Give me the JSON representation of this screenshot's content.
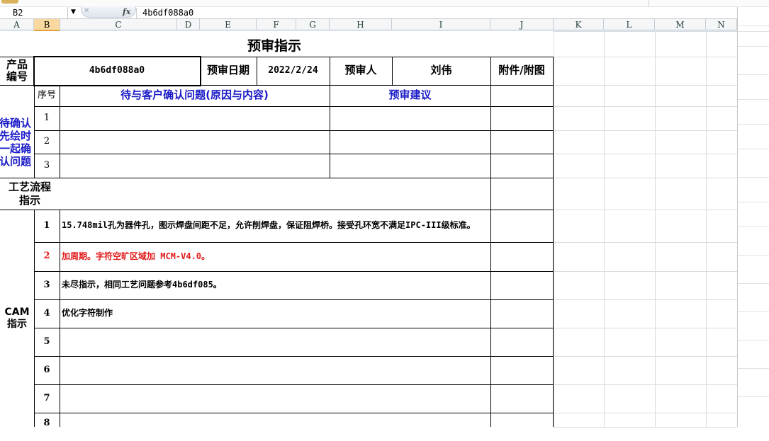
{
  "formula_bar": {
    "name_box": "B2",
    "function_icon": "fx",
    "formula": "4b6df088a0"
  },
  "columns": [
    "A",
    "B",
    "C",
    "D",
    "E",
    "F",
    "G",
    "H",
    "I",
    "J",
    "K",
    "L",
    "M",
    "N"
  ],
  "sheet": {
    "title": "预审指示",
    "product_label": "产品\n编号",
    "product_id": "4b6df088a0",
    "review_date_label": "预审日期",
    "review_date": "2022/2/24",
    "reviewer_label": "预审人",
    "reviewer": "刘伟",
    "attachment_label": "附件/附图",
    "seq_label": "序号",
    "customer_issue_header": "待与客户确认问题(原因与内容)",
    "suggestion_header": "预审建议",
    "confirm_section_label": "待确认\n先绘时\n一起确\n认问题",
    "confirm_rows": [
      "1",
      "2",
      "3"
    ],
    "process_label": "工艺流程\n指示",
    "cam_label": "CAM\n指示",
    "cam_rows": [
      {
        "num": "1",
        "text": "15.748mil孔为器件孔，图示焊盘间距不足，允许削焊盘，保证阻焊桥。接受孔环宽不满足IPC-III级标准。"
      },
      {
        "num": "2",
        "text": "加周期。字符空旷区域加 MCM-V4.0。"
      },
      {
        "num": "3",
        "text": "未尽指示，相同工艺问题参考4b6df085。"
      },
      {
        "num": "4",
        "text": "优化字符制作"
      },
      {
        "num": "5",
        "text": ""
      },
      {
        "num": "6",
        "text": ""
      },
      {
        "num": "7",
        "text": ""
      },
      {
        "num": "8",
        "text": ""
      }
    ]
  },
  "colors": {
    "accent_blue": "#1a1ac8",
    "highlight_red": "#e21b1b",
    "selected_header": "#f9d99f",
    "grid": "#dadcdd"
  }
}
